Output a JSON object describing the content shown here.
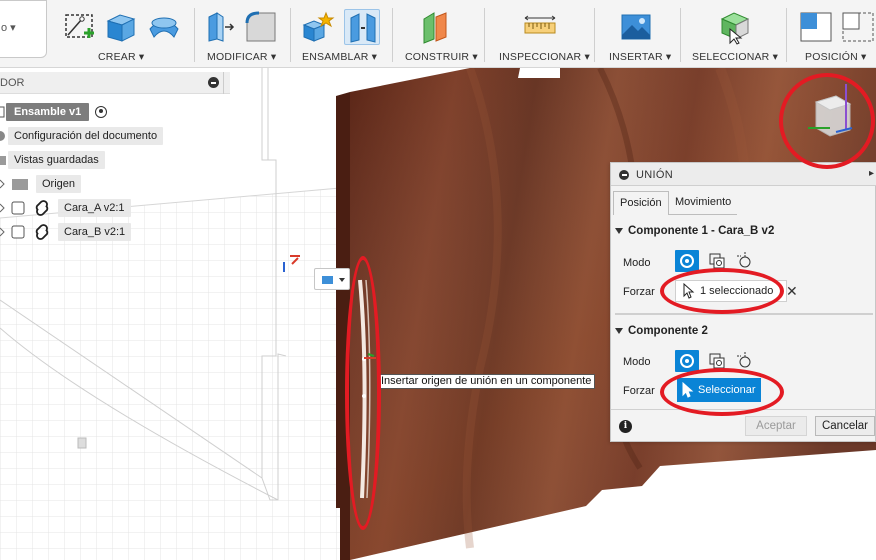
{
  "toolbar": {
    "groups": [
      {
        "label": "CREAR ▾"
      },
      {
        "label": "MODIFICAR ▾"
      },
      {
        "label": "ENSAMBLAR ▾"
      },
      {
        "label": "CONSTRUIR ▾"
      },
      {
        "label": "INSPECCIONAR ▾"
      },
      {
        "label": "INSERTAR ▾"
      },
      {
        "label": "SELECCIONAR ▾"
      },
      {
        "label": "POSICIÓN ▾"
      }
    ],
    "workspace_caret": "o ▾"
  },
  "browser": {
    "title": "DOR",
    "root": "Ensamble v1",
    "items": [
      {
        "label": "Configuración del documento",
        "icon": "gear-icon"
      },
      {
        "label": "Vistas guardadas",
        "icon": "folder-icon"
      },
      {
        "label": "Origen",
        "icon": "folder-icon"
      },
      {
        "label": "Cara_A v2:1",
        "icon": "link-icon"
      },
      {
        "label": "Cara_B v2:1",
        "icon": "link-icon"
      }
    ]
  },
  "tooltip": "Insertar origen de unión en un componente",
  "joint_dialog": {
    "title": "UNIÓN",
    "tabs": [
      "Posición",
      "Movimiento"
    ],
    "active_tab": "Posición",
    "component1": {
      "title": "Componente 1 - Cara_B v2",
      "mode_label": "Modo",
      "snap_label": "Forzar",
      "snap_value": "1 seleccionado"
    },
    "component2": {
      "title": "Componente 2",
      "mode_label": "Modo",
      "snap_label": "Forzar",
      "snap_button": "Seleccionar"
    },
    "ok_label": "Aceptar",
    "cancel_label": "Cancelar"
  },
  "colors": {
    "accent": "#0a84d6",
    "annotation": "#e31b23",
    "wood": "#6b2f1d"
  }
}
